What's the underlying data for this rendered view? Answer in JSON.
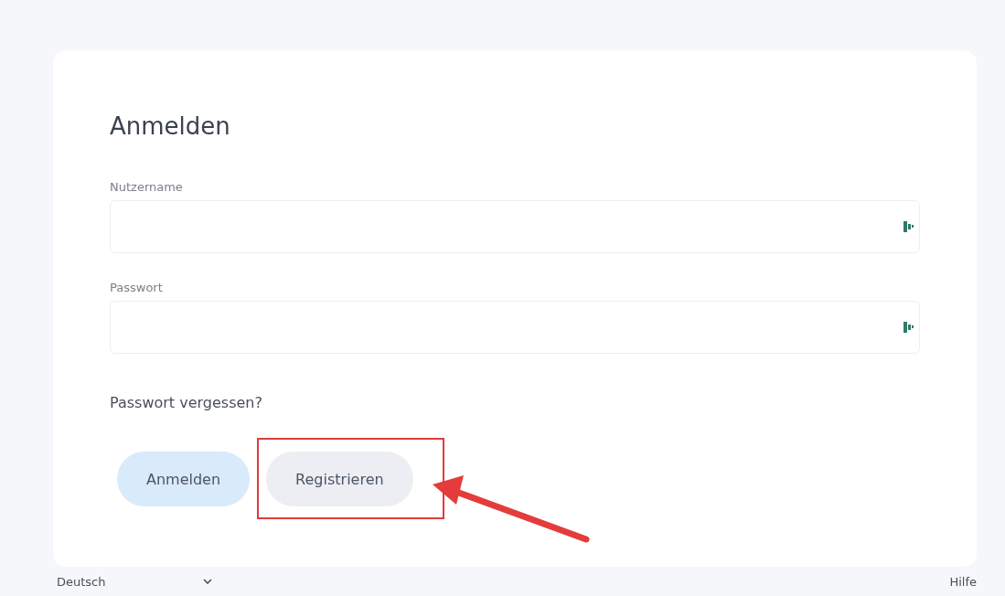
{
  "login_card": {
    "title": "Anmelden",
    "fields": [
      {
        "label": "Nutzername"
      },
      {
        "label": "Passwort"
      }
    ],
    "forgot_link": "Passwort vergessen?",
    "buttons": [
      {
        "label": "Anmelden",
        "kind": "primary"
      },
      {
        "label": "Registrieren",
        "kind": "secondary",
        "highlighted": true
      }
    ]
  },
  "footer": {
    "language": "Deutsch",
    "help_link": "Hilfe"
  }
}
